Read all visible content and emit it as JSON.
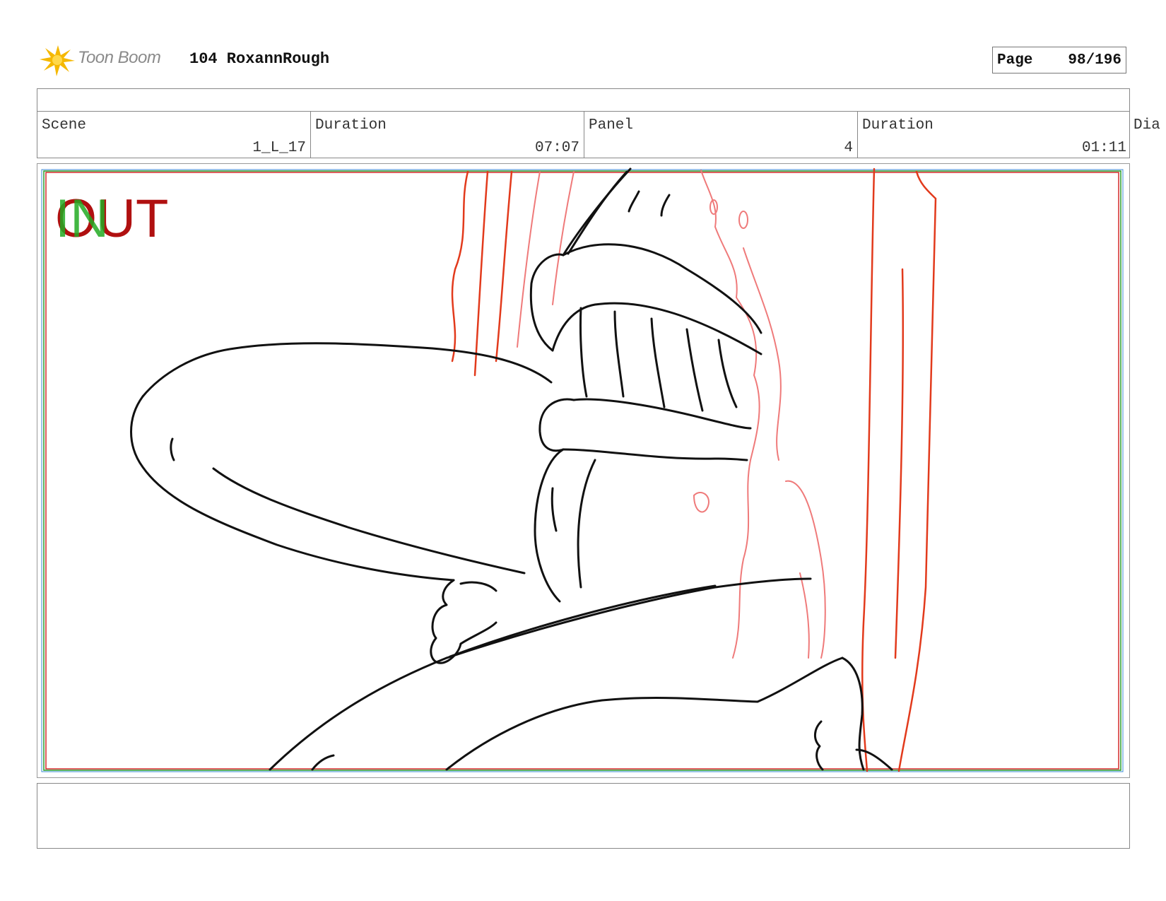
{
  "header": {
    "brand": "Toon Boom",
    "project_title": "104 RoxannRough",
    "page_label": "Page",
    "page_value": "98/196"
  },
  "info": {
    "scene_label": "Scene",
    "scene_value": "1_L_17",
    "scene_duration_label": "Duration",
    "scene_duration_value": "07:07",
    "panel_label": "Panel",
    "panel_value": "4",
    "panel_duration_label": "Duration",
    "panel_duration_value": "01:11",
    "dialog_label": "Dia"
  },
  "panel": {
    "in_marker": "IN",
    "out_marker": "OUT",
    "colors": {
      "in": "#22aa22",
      "out": "#b01010",
      "sketch": "#111111",
      "red_lines": "#e23a1c",
      "pink_lines": "#ef7a7a",
      "frame_red": "#d42a2a",
      "frame_green": "#2a9a2a"
    }
  }
}
